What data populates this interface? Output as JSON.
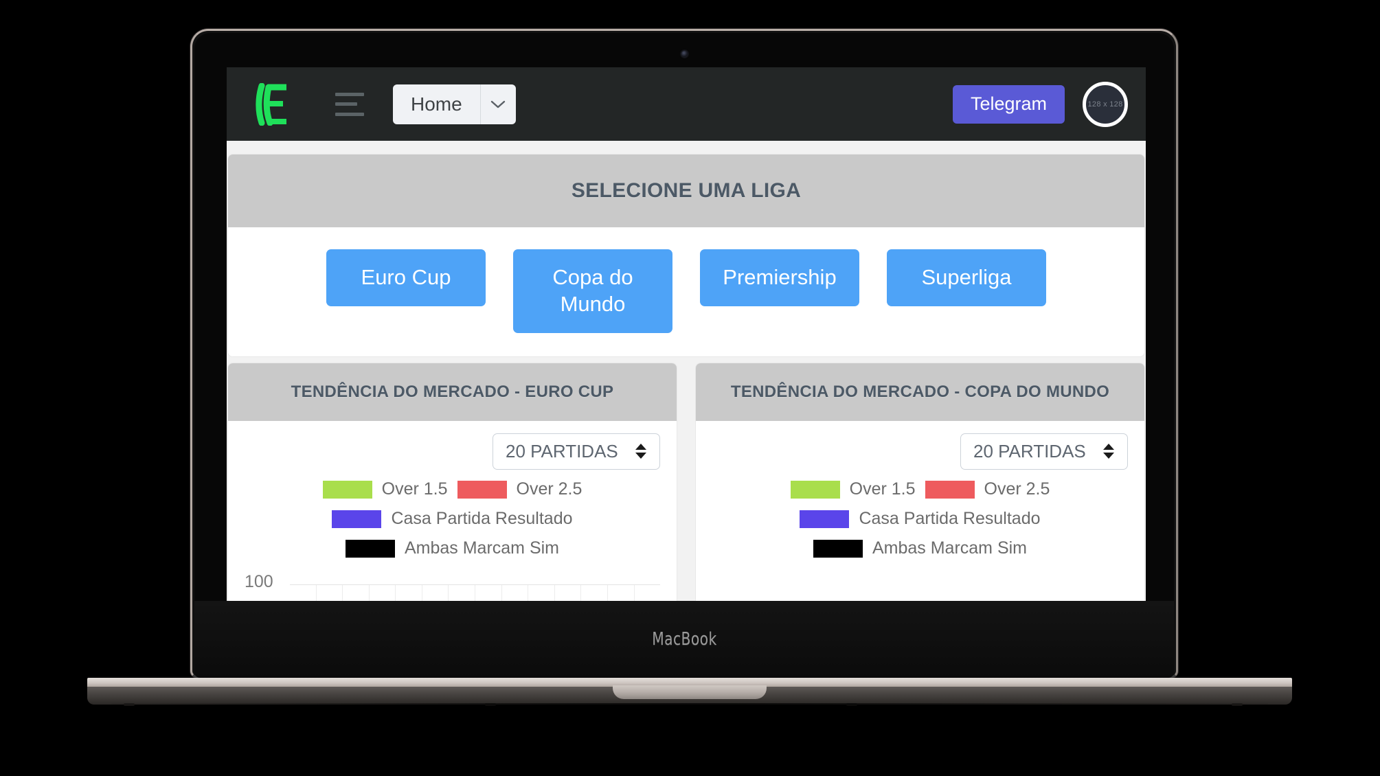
{
  "device": {
    "label": "MacBook",
    "camera": "camera-dot"
  },
  "navbar": {
    "brand_logo": "lE",
    "menu_icon": "hamburger-icon",
    "home_label": "Home",
    "home_caret": "chevron-down-icon",
    "telegram_label": "Telegram",
    "avatar_placeholder": "128 x 128",
    "bg_color": "#232626",
    "telegram_color": "#5a5ad6",
    "brand_color": "#1fe05a"
  },
  "liga_section": {
    "title": "SELECIONE UMA LIGA",
    "button_color": "#4ea3f7",
    "buttons": [
      {
        "label": "Euro Cup"
      },
      {
        "label": "Copa do Mundo"
      },
      {
        "label": "Premiership"
      },
      {
        "label": "Superliga"
      }
    ]
  },
  "panels": [
    {
      "title": "TENDÊNCIA DO MERCADO - EURO CUP",
      "select_value": "20 PARTIDAS",
      "select_options": [
        "20 PARTIDAS"
      ],
      "legend": [
        {
          "label": "Over 1.5",
          "color": "#a9de4c"
        },
        {
          "label": "Over 2.5",
          "color": "#ee5b5e"
        },
        {
          "label": "Casa Partida Resultado",
          "color": "#5a45ea"
        },
        {
          "label": "Ambas Marcam Sim",
          "color": "#000000"
        }
      ],
      "chart_data": {
        "type": "bar",
        "title": "TENDÊNCIA DO MERCADO - EURO CUP",
        "xlabel": "",
        "ylabel": "",
        "ylim": [
          0,
          100
        ],
        "ytick_labels": [
          "100"
        ],
        "grid": true,
        "legend_position": "top",
        "categories": [],
        "series": [
          {
            "name": "Over 1.5",
            "color": "#a9de4c",
            "values": []
          },
          {
            "name": "Over 2.5",
            "color": "#ee5b5e",
            "values": []
          },
          {
            "name": "Casa Partida Resultado",
            "color": "#5a45ea",
            "values": []
          },
          {
            "name": "Ambas Marcam Sim",
            "color": "#000000",
            "values": []
          }
        ]
      }
    },
    {
      "title": "TENDÊNCIA DO MERCADO - COPA DO MUNDO",
      "select_value": "20 PARTIDAS",
      "select_options": [
        "20 PARTIDAS"
      ],
      "legend": [
        {
          "label": "Over 1.5",
          "color": "#a9de4c"
        },
        {
          "label": "Over 2.5",
          "color": "#ee5b5e"
        },
        {
          "label": "Casa Partida Resultado",
          "color": "#5a45ea"
        },
        {
          "label": "Ambas Marcam Sim",
          "color": "#000000"
        }
      ],
      "chart_data": {
        "type": "bar",
        "title": "TENDÊNCIA DO MERCADO - COPA DO MUNDO",
        "xlabel": "",
        "ylabel": "",
        "ylim": [
          0,
          100
        ],
        "ytick_labels": [],
        "grid": true,
        "legend_position": "top",
        "categories": [],
        "series": [
          {
            "name": "Over 1.5",
            "color": "#a9de4c",
            "values": []
          },
          {
            "name": "Over 2.5",
            "color": "#ee5b5e",
            "values": []
          },
          {
            "name": "Casa Partida Resultado",
            "color": "#5a45ea",
            "values": []
          },
          {
            "name": "Ambas Marcam Sim",
            "color": "#000000",
            "values": []
          }
        ]
      }
    }
  ]
}
